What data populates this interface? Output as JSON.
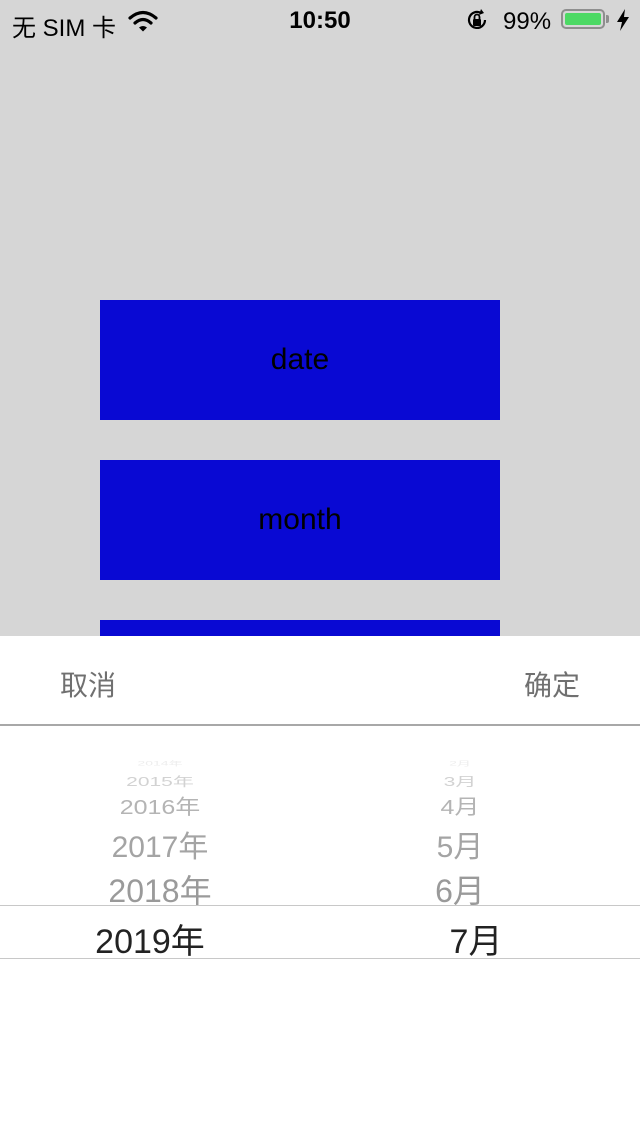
{
  "status_bar": {
    "carrier": "无 SIM 卡",
    "time": "10:50",
    "battery_percent": "99%",
    "battery_level": 0.99,
    "icons": [
      "wifi-icon",
      "orientation-lock-icon",
      "battery-icon",
      "charging-bolt-icon"
    ],
    "battery_color": "#4cd964"
  },
  "buttons": [
    {
      "label": "date"
    },
    {
      "label": "month"
    },
    {
      "label": ""
    }
  ],
  "accent_color": "#0909d3",
  "picker": {
    "cancel_label": "取消",
    "confirm_label": "确定",
    "years": [
      "2014年",
      "2015年",
      "2016年",
      "2017年",
      "2018年",
      "2019年"
    ],
    "months": [
      "2月",
      "3月",
      "4月",
      "5月",
      "6月",
      "7月"
    ],
    "selected_year": "2019年",
    "selected_month": "7月"
  }
}
